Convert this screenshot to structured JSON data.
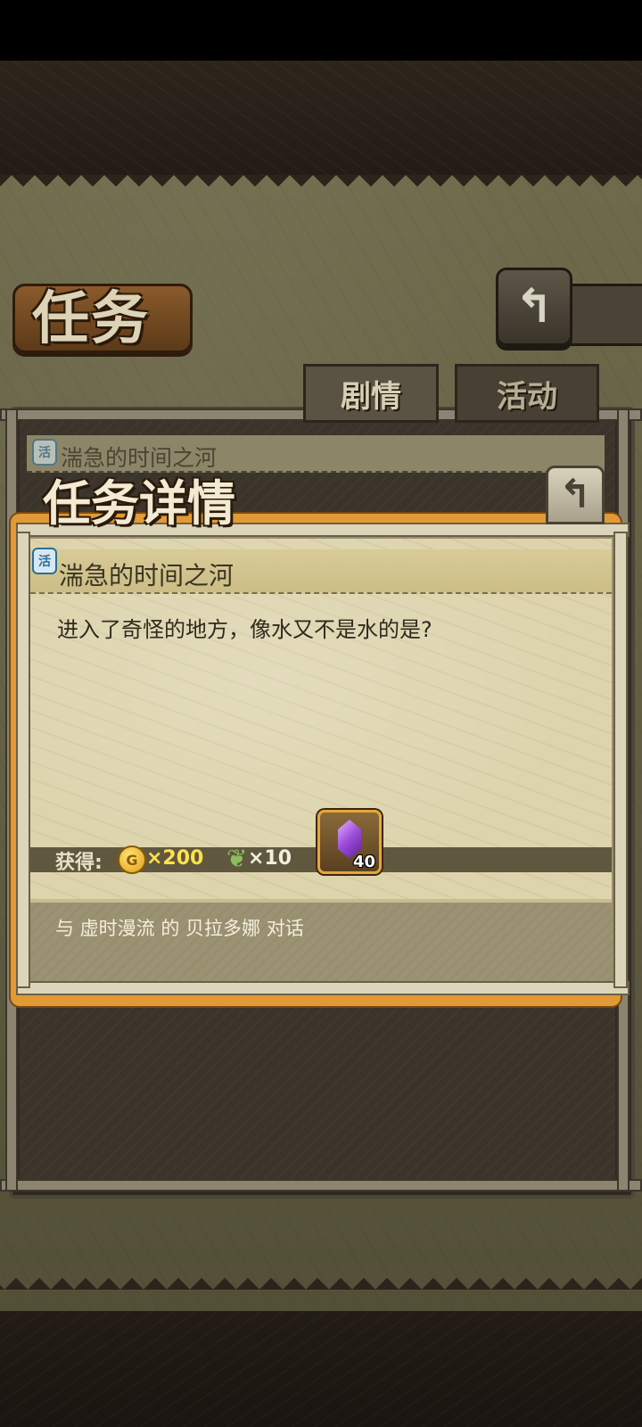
{
  "screen": {
    "title": "任务",
    "tabs": [
      {
        "label": "剧情",
        "active": true
      },
      {
        "label": "活动",
        "active": false
      }
    ],
    "list_item": {
      "badge": "活",
      "name": "湍急的时间之河"
    }
  },
  "detail": {
    "title": "任务详情",
    "badge": "活",
    "quest_name": "湍急的时间之河",
    "description": "进入了奇怪的地方，像水又不是水的是?",
    "rewards": {
      "label": "获得:",
      "coin_icon": "G",
      "coin_amount": "×200",
      "feather_amount": "×10",
      "item_count": "40"
    },
    "objective": "与 虚时漫流 的 贝拉多娜 对话"
  },
  "colors": {
    "popup_border": "#e19a35",
    "coin_amount": "#ffe14a",
    "badge": "#2a6f9a"
  }
}
